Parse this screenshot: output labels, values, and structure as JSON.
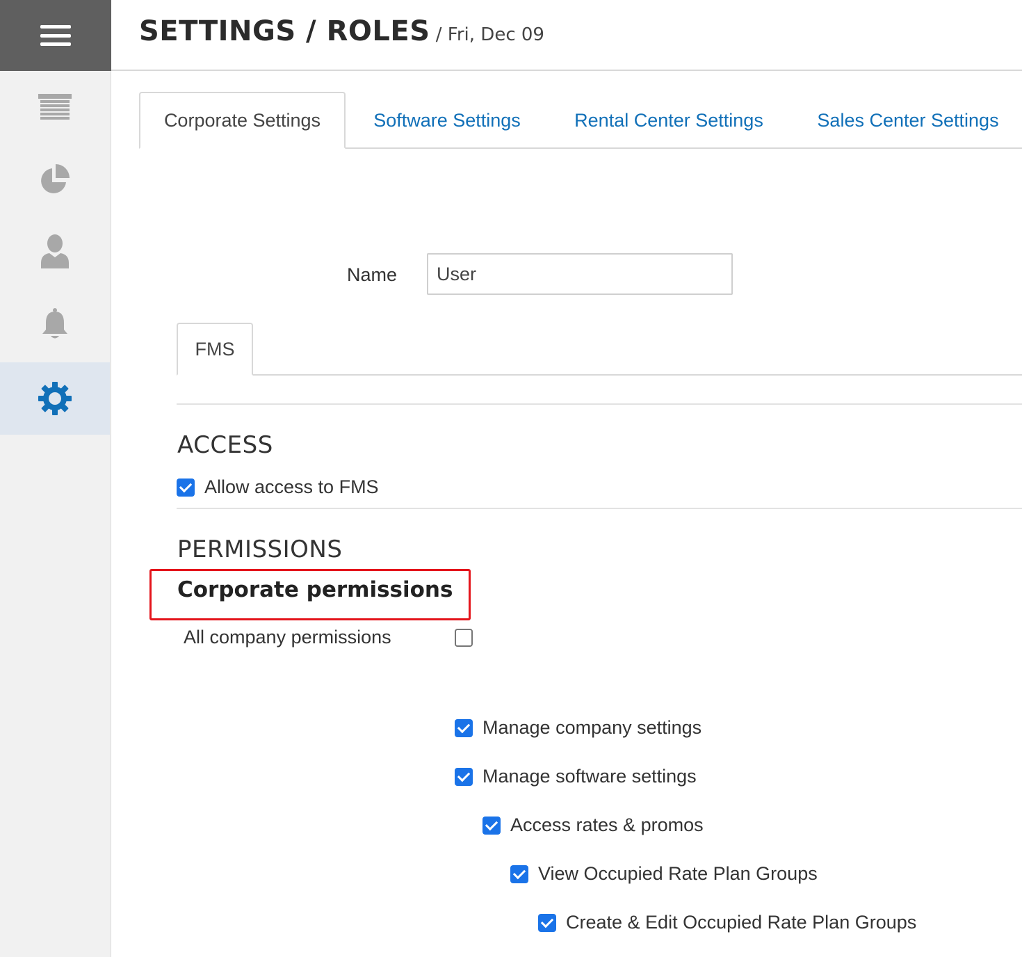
{
  "header": {
    "title": "SETTINGS / ROLES",
    "date": " / Fri, Dec 09"
  },
  "sidebar": {
    "items": [
      {
        "icon": "warehouse-icon"
      },
      {
        "icon": "pie-chart-icon"
      },
      {
        "icon": "user-icon"
      },
      {
        "icon": "bell-icon"
      },
      {
        "icon": "gear-icon",
        "active": true
      }
    ],
    "active_color": "#1170b8"
  },
  "tabs": [
    {
      "label": "Corporate Settings",
      "active": true
    },
    {
      "label": "Software Settings"
    },
    {
      "label": "Rental Center Settings"
    },
    {
      "label": "Sales Center Settings"
    }
  ],
  "form": {
    "name_label": "Name",
    "name_value": "User"
  },
  "subtabs": [
    {
      "label": "FMS",
      "active": true
    }
  ],
  "access": {
    "title": "ACCESS",
    "allow_label": "Allow access to FMS",
    "allow_checked": true
  },
  "permissions": {
    "title": "PERMISSIONS",
    "group_title": "Corporate permissions",
    "all_label": "All company permissions",
    "all_checked": false,
    "items": [
      {
        "label": "Manage company settings",
        "checked": true
      },
      {
        "label": "Manage software settings",
        "checked": true
      },
      {
        "label": "Access rates & promos",
        "checked": true
      },
      {
        "label": "View Occupied Rate Plan Groups",
        "checked": true
      },
      {
        "label": "Create & Edit Occupied Rate Plan Groups",
        "checked": true
      }
    ]
  },
  "colors": {
    "link": "#1170b8",
    "checkbox": "#1a73e8",
    "highlight": "#e4141b"
  }
}
